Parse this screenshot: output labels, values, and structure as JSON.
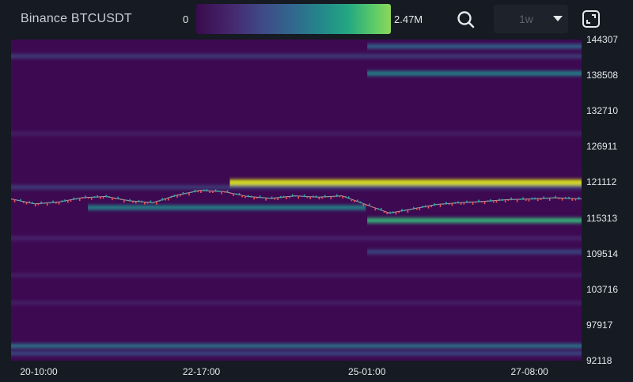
{
  "header": {
    "title": "Binance BTCUSDT",
    "scale_min": "0",
    "scale_max": "2.47M",
    "timeframe": "1w",
    "colorscale": [
      "#3a0b4d",
      "#46276e",
      "#3f4a86",
      "#31688e",
      "#23878a",
      "#23a783",
      "#5fcc67",
      "#8ed65a",
      "#dce319"
    ],
    "search_icon": "search-icon",
    "expand_icon": "expand-icon"
  },
  "chart_data": {
    "type": "heatmap",
    "title": "Binance BTCUSDT",
    "ylim": [
      92118,
      144307
    ],
    "y_ticks": [
      "144307",
      "138508",
      "132710",
      "126911",
      "121112",
      "115313",
      "109514",
      "103716",
      "97917",
      "92118"
    ],
    "x_ticks": [
      "20-10:00",
      "22-17:00",
      "25-01:00",
      "27-08:00"
    ],
    "x_range": [
      "2025-07-20 00:00",
      "2025-07-28 01:00"
    ],
    "liquidity_bands": [
      {
        "price": 143200,
        "start": "2025-07-25 00:30",
        "end": "2025-07-28 01:00",
        "intensity": 0.45
      },
      {
        "price": 141600,
        "start": "2025-07-20 00:00",
        "end": "2025-07-28 01:00",
        "intensity": 0.3
      },
      {
        "price": 138800,
        "start": "2025-07-25 00:30",
        "end": "2025-07-28 01:00",
        "intensity": 0.55
      },
      {
        "price": 129000,
        "start": "2025-07-20 00:00",
        "end": "2025-07-28 01:00",
        "intensity": 0.15
      },
      {
        "price": 121100,
        "start": "2025-07-23 02:00",
        "end": "2025-07-28 01:00",
        "intensity": 1.0
      },
      {
        "price": 120300,
        "start": "2025-07-20 00:00",
        "end": "2025-07-28 01:00",
        "intensity": 0.3
      },
      {
        "price": 117000,
        "start": "2025-07-21 02:00",
        "end": "2025-07-25 00:00",
        "intensity": 0.55
      },
      {
        "price": 114900,
        "start": "2025-07-25 00:30",
        "end": "2025-07-28 01:00",
        "intensity": 0.75
      },
      {
        "price": 112000,
        "start": "2025-07-20 00:00",
        "end": "2025-07-28 01:00",
        "intensity": 0.2
      },
      {
        "price": 109800,
        "start": "2025-07-25 00:30",
        "end": "2025-07-28 01:00",
        "intensity": 0.35
      },
      {
        "price": 106000,
        "start": "2025-07-20 00:00",
        "end": "2025-07-28 01:00",
        "intensity": 0.15
      },
      {
        "price": 101500,
        "start": "2025-07-20 00:00",
        "end": "2025-07-28 01:00",
        "intensity": 0.15
      },
      {
        "price": 94500,
        "start": "2025-07-20 00:00",
        "end": "2025-07-28 01:00",
        "intensity": 0.5
      },
      {
        "price": 93300,
        "start": "2025-07-20 00:00",
        "end": "2025-07-28 01:00",
        "intensity": 0.35
      }
    ],
    "price_series": [
      {
        "t": "2025-07-20 00:00",
        "p": 118400
      },
      {
        "t": "2025-07-20 08:00",
        "p": 117600
      },
      {
        "t": "2025-07-20 16:00",
        "p": 117900
      },
      {
        "t": "2025-07-21 00:00",
        "p": 118600
      },
      {
        "t": "2025-07-21 08:00",
        "p": 118800
      },
      {
        "t": "2025-07-21 16:00",
        "p": 118100
      },
      {
        "t": "2025-07-22 00:00",
        "p": 117800
      },
      {
        "t": "2025-07-22 08:00",
        "p": 119000
      },
      {
        "t": "2025-07-22 16:00",
        "p": 119800
      },
      {
        "t": "2025-07-23 00:00",
        "p": 119600
      },
      {
        "t": "2025-07-23 08:00",
        "p": 118800
      },
      {
        "t": "2025-07-23 16:00",
        "p": 118500
      },
      {
        "t": "2025-07-24 00:00",
        "p": 118900
      },
      {
        "t": "2025-07-24 08:00",
        "p": 118700
      },
      {
        "t": "2025-07-24 16:00",
        "p": 118900
      },
      {
        "t": "2025-07-25 00:00",
        "p": 117500
      },
      {
        "t": "2025-07-25 08:00",
        "p": 116100
      },
      {
        "t": "2025-07-25 16:00",
        "p": 116800
      },
      {
        "t": "2025-07-26 00:00",
        "p": 117500
      },
      {
        "t": "2025-07-26 08:00",
        "p": 117800
      },
      {
        "t": "2025-07-26 16:00",
        "p": 118000
      },
      {
        "t": "2025-07-27 00:00",
        "p": 118300
      },
      {
        "t": "2025-07-27 08:00",
        "p": 118400
      },
      {
        "t": "2025-07-27 16:00",
        "p": 118600
      },
      {
        "t": "2025-07-28 01:00",
        "p": 118400
      }
    ]
  }
}
